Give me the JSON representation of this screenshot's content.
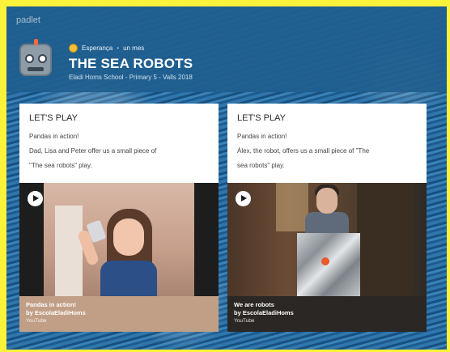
{
  "app": {
    "brand": "padlet"
  },
  "header": {
    "author": "Esperança",
    "time": "un mes",
    "separator": "•",
    "title": "THE SEA ROBOTS",
    "subtitle": "Eladi Homs School - Primary 5 - Valls 2018"
  },
  "cards": [
    {
      "title": "LET'S PLAY",
      "line1": "Pandas in action!",
      "line2": "Dad, Lisa and Peter offer us a small piece of",
      "line3": "\"The sea robots\" play.",
      "video": {
        "title": "Pandas in action!",
        "by": "by EscolaEladiHoms",
        "source": "YouTube"
      }
    },
    {
      "title": "LET'S PLAY",
      "line1": "Pandas in action!",
      "line2": "Àlex, the robot, offers us a small piece of \"The",
      "line3": "sea robots\" play.",
      "video": {
        "title": "We are robots",
        "by": "by EscolaEladiHoms",
        "source": "YouTube"
      }
    }
  ],
  "icons": {
    "play": "play-icon",
    "avatar": "robot-avatar-icon"
  },
  "colors": {
    "header": "#205e8e",
    "highlight_frame": "#fdf23a"
  }
}
